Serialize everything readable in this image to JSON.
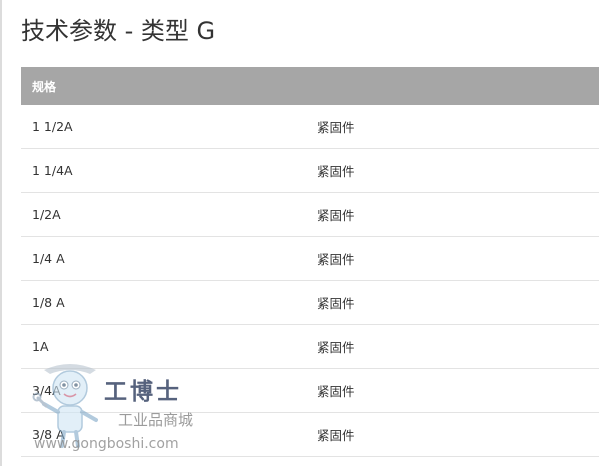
{
  "page": {
    "title": "技术参数 - 类型 G"
  },
  "table": {
    "header": "规格",
    "rows": [
      {
        "spec": "1 1/2A",
        "type": "紧固件"
      },
      {
        "spec": "1 1/4A",
        "type": "紧固件"
      },
      {
        "spec": "1/2A",
        "type": "紧固件"
      },
      {
        "spec": "1/4 A",
        "type": "紧固件"
      },
      {
        "spec": "1/8 A",
        "type": "紧固件"
      },
      {
        "spec": "1A",
        "type": "紧固件"
      },
      {
        "spec": "3/4A",
        "type": "紧固件"
      },
      {
        "spec": "3/8 A",
        "type": "紧固件"
      }
    ]
  },
  "watermark": {
    "brand": "工博士",
    "slogan": "工业品商城",
    "url": "www.gongboshi.com"
  },
  "colors": {
    "header_bg": "#a6a6a6",
    "header_text": "#ffffff",
    "row_border": "#e3e3e3",
    "title_text": "#333333"
  }
}
